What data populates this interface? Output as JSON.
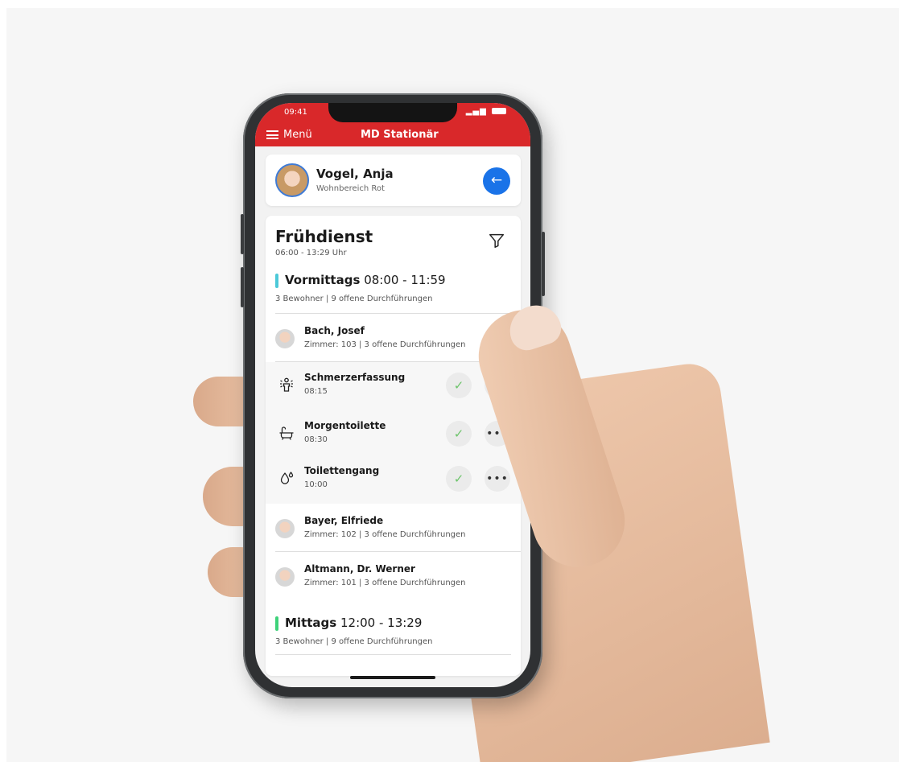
{
  "status_bar": {
    "time": "09:41",
    "signal_text": "▂▄▆"
  },
  "header": {
    "menu_label": "Menü",
    "title": "MD Stationär"
  },
  "user": {
    "name": "Vogel, Anja",
    "subtitle": "Wohnbereich Rot",
    "back_arrow": "←"
  },
  "shift": {
    "title": "Frühdienst",
    "time": "06:00 - 13:29 Uhr"
  },
  "sections": [
    {
      "name": "Vormittags",
      "time": "08:00 - 11:59",
      "summary": "3 Bewohner | 9 offene Durchführungen",
      "color": "#4cc9d8"
    },
    {
      "name": "Mittags",
      "time": "12:00 - 13:29",
      "summary": "3 Bewohner | 9 offene Durchführungen",
      "color": "#3ed27a"
    }
  ],
  "residents": [
    {
      "name": "Bach, Josef",
      "details": "Zimmer: 103 | 3 offene Durchführungen"
    },
    {
      "name": "Bayer, Elfriede",
      "details": "Zimmer: 102 | 3 offene Durchführungen"
    },
    {
      "name": "Altmann, Dr. Werner",
      "details": "Zimmer: 101 | 3 offene Durchführungen"
    }
  ],
  "tasks": [
    {
      "name": "Schmerzerfassung",
      "time": "08:15",
      "icon": "pain-assessment-icon"
    },
    {
      "name": "Morgentoilette",
      "time": "08:30",
      "icon": "bathtub-icon"
    },
    {
      "name": "Toilettengang",
      "time": "10:00",
      "icon": "drops-icon"
    }
  ],
  "task_actions": {
    "check": "✓",
    "more": "•••"
  },
  "colors": {
    "brand_red": "#d9282a",
    "accent_blue": "#1a73e8",
    "check_green": "#6cc46a"
  }
}
